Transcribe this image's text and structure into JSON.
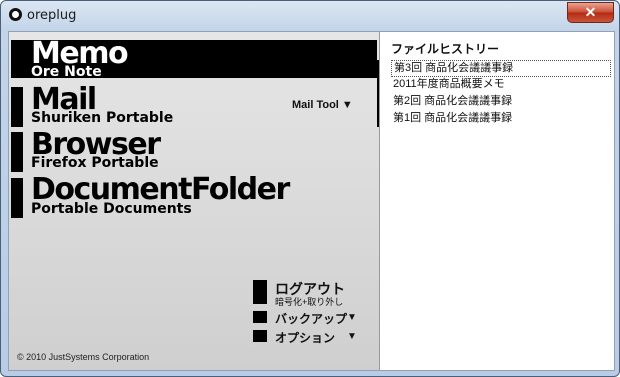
{
  "window": {
    "title": "oreplug",
    "close_label": "✕"
  },
  "launcher": {
    "memo": {
      "title": "Memo",
      "subtitle": "Ore Note"
    },
    "mail": {
      "title": "Mail",
      "subtitle": "Shuriken Portable",
      "tool_label": "Mail Tool ▼"
    },
    "browser": {
      "title": "Browser",
      "subtitle": "Firefox Portable"
    },
    "document": {
      "title": "DocumentFolder",
      "subtitle": "Portable Documents"
    }
  },
  "menu": {
    "logout": {
      "label": "ログアウト",
      "sublabel": "暗号化+取り外し"
    },
    "backup": {
      "label": "バックアップ",
      "arrow": "▼"
    },
    "options": {
      "label": "オプション",
      "arrow": "▼"
    }
  },
  "copyright": "© 2010 JustSystems Corporation",
  "history": {
    "title": "ファイルヒストリー",
    "items": [
      "第3回 商品化会議議事録",
      "2011年度商品概要メモ",
      "第2回 商品化会議議事録",
      "第1回 商品化会議議事録"
    ]
  }
}
